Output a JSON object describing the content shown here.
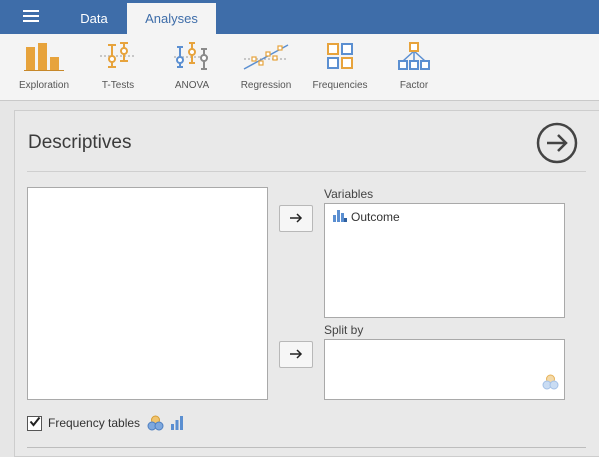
{
  "header": {
    "menu_icon": "hamburger-menu-icon",
    "tabs": [
      {
        "label": "Data",
        "active": false
      },
      {
        "label": "Analyses",
        "active": true
      }
    ],
    "bar_color": "#3e6da9"
  },
  "ribbon": {
    "items": [
      {
        "label": "Exploration",
        "icon": "exploration-bar-icon"
      },
      {
        "label": "T-Tests",
        "icon": "t-tests-icon"
      },
      {
        "label": "ANOVA",
        "icon": "anova-icon"
      },
      {
        "label": "Regression",
        "icon": "regression-icon"
      },
      {
        "label": "Frequencies",
        "icon": "frequencies-icon"
      },
      {
        "label": "Factor",
        "icon": "factor-icon"
      }
    ],
    "accent_color": "#e7a33c"
  },
  "analysis": {
    "title": "Descriptives",
    "run_icon": "circle-arrow-right-icon",
    "variables_label": "Variables",
    "variables": [
      {
        "name": "Outcome",
        "icon": "continuous-variable-icon"
      }
    ],
    "split_by_label": "Split by",
    "split_by_icon": "nominal-variable-icon",
    "frequency_tables": {
      "label": "Frequency tables",
      "checked": true,
      "icons": [
        "nominal-variable-icon",
        "ordinal-variable-icon"
      ]
    }
  }
}
